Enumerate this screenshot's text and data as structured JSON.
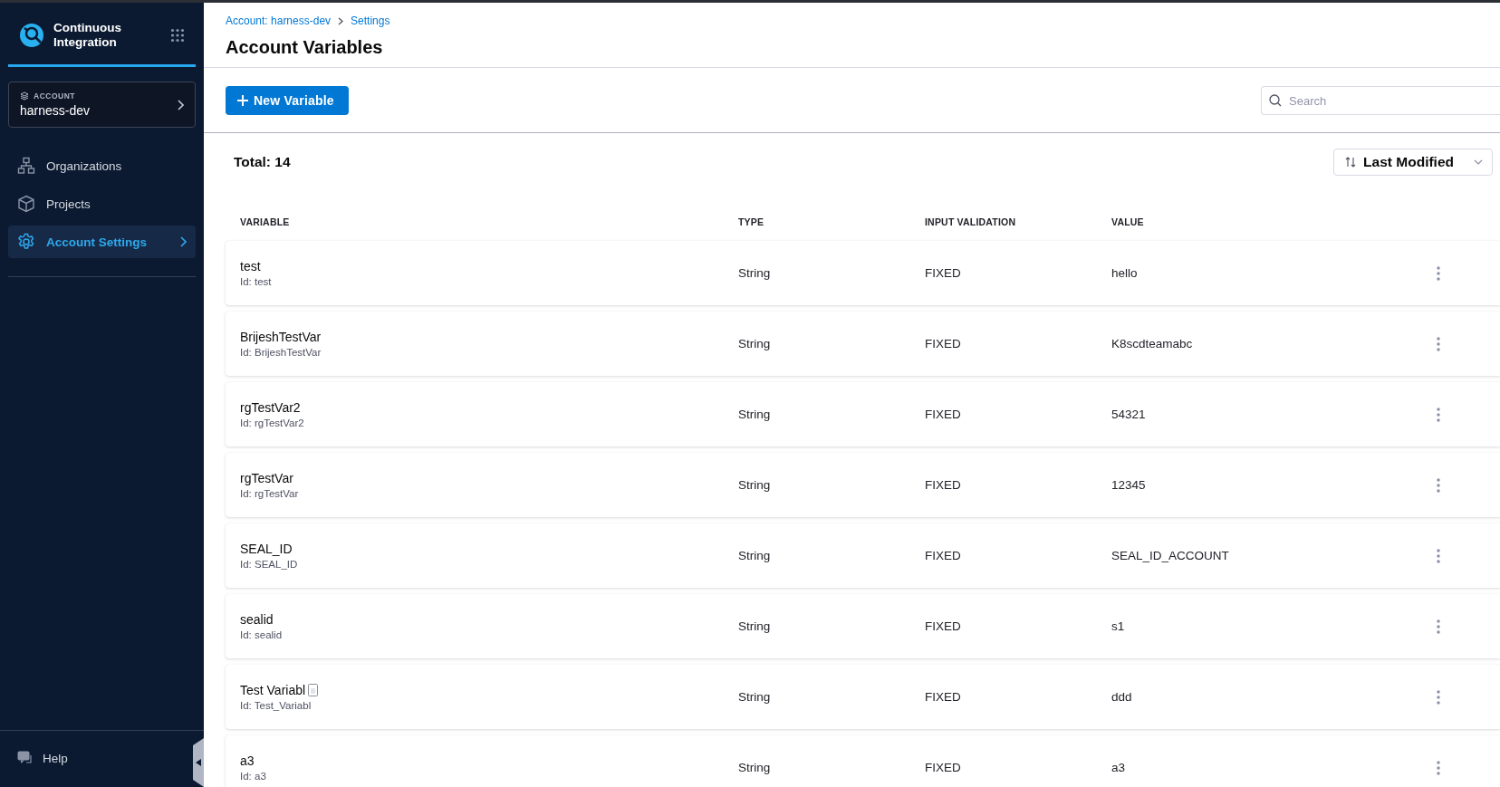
{
  "app": {
    "title": "Continuous Integration"
  },
  "account": {
    "label": "ACCOUNT",
    "name": "harness-dev"
  },
  "nav": [
    {
      "label": "Organizations",
      "kind": "org",
      "selected": false
    },
    {
      "label": "Projects",
      "kind": "cube",
      "selected": false
    },
    {
      "label": "Account Settings",
      "kind": "gear",
      "selected": true
    }
  ],
  "help": {
    "label": "Help"
  },
  "breadcrumbs": [
    "Account: harness-dev",
    "Settings"
  ],
  "title": "Account Variables",
  "new_button": "New Variable",
  "search": {
    "placeholder": "Search"
  },
  "total": "Total: 14",
  "sort": "Last Modified",
  "columns": [
    "VARIABLE",
    "TYPE",
    "INPUT VALIDATION",
    "VALUE"
  ],
  "rows": [
    {
      "name": "test",
      "id": "Id: test",
      "type": "String",
      "validation": "FIXED",
      "value": "hello",
      "glyph_box": false
    },
    {
      "name": "BrijeshTestVar",
      "id": "Id: BrijeshTestVar",
      "type": "String",
      "validation": "FIXED",
      "value": "K8scdteamabc",
      "glyph_box": false
    },
    {
      "name": "rgTestVar2",
      "id": "Id: rgTestVar2",
      "type": "String",
      "validation": "FIXED",
      "value": "54321",
      "glyph_box": false
    },
    {
      "name": "rgTestVar",
      "id": "Id: rgTestVar",
      "type": "String",
      "validation": "FIXED",
      "value": "12345",
      "glyph_box": false
    },
    {
      "name": "SEAL_ID",
      "id": "Id: SEAL_ID",
      "type": "String",
      "validation": "FIXED",
      "value": "SEAL_ID_ACCOUNT",
      "glyph_box": false
    },
    {
      "name": "sealid",
      "id": "Id: sealid",
      "type": "String",
      "validation": "FIXED",
      "value": "s1",
      "glyph_box": false
    },
    {
      "name": "Test Variabl",
      "id": "Id: Test_Variabl",
      "type": "String",
      "validation": "FIXED",
      "value": "ddd",
      "glyph_box": true
    },
    {
      "name": "a3",
      "id": "Id: a3",
      "type": "String",
      "validation": "FIXED",
      "value": "a3",
      "glyph_box": false
    }
  ]
}
